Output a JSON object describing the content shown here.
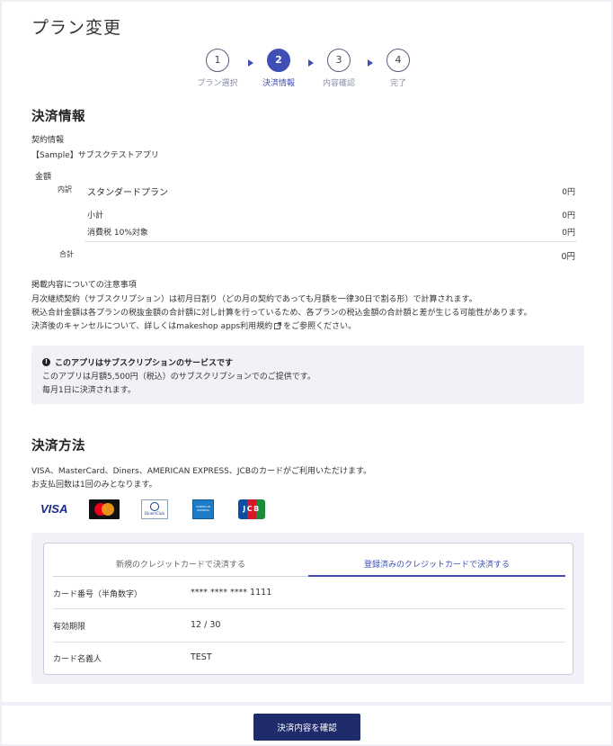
{
  "page": {
    "title": "プラン変更"
  },
  "stepper": [
    {
      "number": "1",
      "label": "プラン選択",
      "active": false
    },
    {
      "number": "2",
      "label": "決済情報",
      "active": true
    },
    {
      "number": "3",
      "label": "内容確認",
      "active": false
    },
    {
      "number": "4",
      "label": "完了",
      "active": false
    }
  ],
  "payment_info": {
    "heading": "決済情報",
    "contract_label": "契約情報",
    "contract_name": "【Sample】サブスクテストアプリ",
    "amount_label": "金額",
    "breakdown_label": "内訳",
    "plan_name": "スタンダードプラン",
    "plan_price": "0円",
    "subtotal_label": "小計",
    "subtotal_value": "0円",
    "tax_label": "消費税 10%対象",
    "tax_value": "0円",
    "total_label": "合計",
    "total_value": "0円"
  },
  "notes": {
    "title": "掲載内容についての注意事項",
    "line1": "月次継続契約（サブスクリプション）は初月日割り（どの月の契約であっても月額を一律30日で割る形）で計算されます。",
    "line2": "税込合計金額は各プランの税抜金額の合計額に対し計算を行っているため、各プランの税込金額の合計額と差が生じる可能性があります。",
    "line3_prefix": "決済後のキャンセルについて、詳しくはmakeshop apps利用規約",
    "line3_suffix": "をご参照ください。"
  },
  "notice": {
    "icon": "info-icon",
    "title": "このアプリはサブスクリプションのサービスです",
    "line1": "このアプリは月額5,500円（税込）のサブスクリプションでのご提供です。",
    "line2": "毎月1日に決済されます。"
  },
  "payment_method": {
    "heading": "決済方法",
    "desc1": "VISA、MasterCard、Diners、AMERICAN EXPRESS、JCBのカードがご利用いただけます。",
    "desc2": "お支払回数は1回のみとなります。",
    "logos": {
      "visa": "VISA",
      "diners": "DinersClub",
      "amex": "AMERICAN EXPRESS",
      "jcb": "JCB"
    },
    "tabs": [
      {
        "label": "新規のクレジットカードで決済する",
        "active": false
      },
      {
        "label": "登録済みのクレジットカードで決済する",
        "active": true
      }
    ],
    "card_number_label": "カード番号（半角数字）",
    "card_number_value": "**** **** **** 1111",
    "expiry_label": "有効期限",
    "expiry_value": "12 / 30",
    "holder_label": "カード名義人",
    "holder_value": "TEST"
  },
  "footer": {
    "confirm_label": "決済内容を確認"
  },
  "colors": {
    "accent": "#3f4fb5",
    "button": "#1f2b6b",
    "panel": "#f1f2f8"
  }
}
